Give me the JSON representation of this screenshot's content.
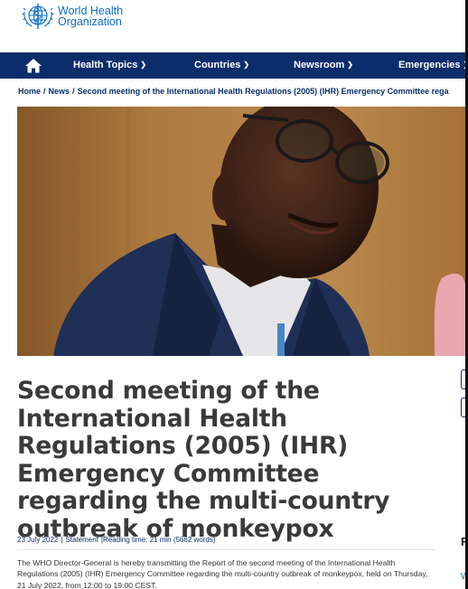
{
  "header": {
    "logo_line1": "World Health",
    "logo_line2": "Organization"
  },
  "nav": {
    "items": [
      {
        "label": "Health Topics"
      },
      {
        "label": "Countries"
      },
      {
        "label": "Newsroom"
      },
      {
        "label": "Emergencies"
      }
    ]
  },
  "breadcrumb": {
    "home": "Home",
    "news": "News",
    "current": "Second meeting of the International Health Regulations (2005) (IHR) Emergency Committee rega"
  },
  "article": {
    "title": "Second meeting of the International Health Regulations (2005) (IHR) Emergency Committee regarding the multi-country outbreak of monkeypox",
    "date": "23 July 2022",
    "type": "Statement",
    "reading_time": "Reading time: 21 min (5662 words)",
    "intro": "The WHO Director-General is hereby transmitting the Report of the second meeting of the International Health Regulations (2005) (IHR) Emergency Committee regarding the multi-country outbreak of monkeypox, held on Thursday, 21 July 2022, from 12:00 to 19:00 CEST."
  },
  "sidebar": {
    "heading_fragment": "R",
    "link_fragment": "W"
  }
}
